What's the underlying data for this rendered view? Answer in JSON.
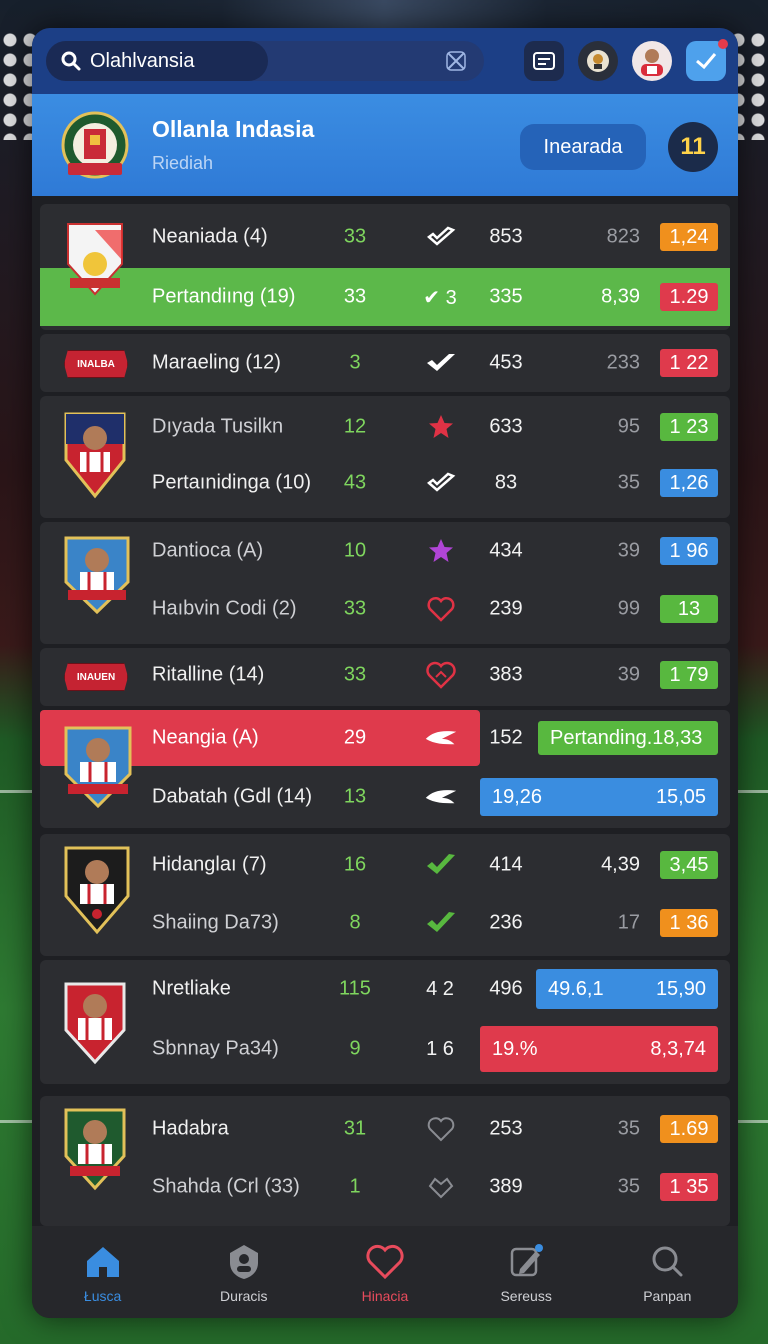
{
  "search": {
    "value": "Olahlvansia"
  },
  "header": {
    "title": "Ollanla Indasia",
    "subtitle": "Riediah",
    "button": "Inearada",
    "badge": "11"
  },
  "colors": {
    "accent": "#2f7ad6",
    "green": "#58b83f",
    "red": "#df3a4c",
    "orange": "#f0901d",
    "blue": "#3a8de0"
  },
  "rows": [
    {
      "name": "Neaniada (4)",
      "v1": "33",
      "icon": "check-icon",
      "v2": "853",
      "v3": "823",
      "pill": "1,24",
      "pill_color": "orange"
    },
    {
      "name": "Pertandiıng (19)",
      "v1": "33",
      "icon_text": "✔ 3",
      "v2": "335",
      "v3": "8,39",
      "pill": "1.29",
      "pill_color": "red"
    },
    {
      "name": "Maraeling (12)",
      "v1": "3",
      "icon": "check-icon",
      "v2": "453",
      "v3": "233",
      "pill": "1 22",
      "pill_color": "red"
    },
    {
      "name": "Dıyada Tusilkn",
      "v1": "12",
      "icon": "star-icon",
      "v2": "633",
      "v3": "95",
      "pill": "1 23",
      "pill_color": "green"
    },
    {
      "name": "Pertaınidinga (10)",
      "v1": "43",
      "icon": "check-icon",
      "v2": "83",
      "v3": "35",
      "pill": "1,26",
      "pill_color": "blue"
    },
    {
      "name": "Dantioca (A)",
      "v1": "10",
      "icon": "star-icon",
      "v2": "434",
      "v3": "39",
      "pill": "1 96",
      "pill_color": "blue"
    },
    {
      "name": "Haıbvin Codi (2)",
      "v1": "33",
      "icon": "heart-icon",
      "v2": "239",
      "v3": "99",
      "pill": "13",
      "pill_color": "green"
    },
    {
      "name": "Ritalline (14)",
      "v1": "33",
      "icon": "heart-icon",
      "v2": "383",
      "v3": "39",
      "pill": "1 79",
      "pill_color": "green"
    },
    {
      "name": "Neangia (A)",
      "v1": "29",
      "icon": "wing-icon",
      "v2": "152",
      "wide": "Pertanding.18,33"
    },
    {
      "name": "Dabatah (Gdl (14)",
      "v1": "13",
      "icon": "wing-icon",
      "wide_left": "19,26",
      "wide_right": "15,05"
    },
    {
      "name": "Hidanglaı (7)",
      "v1": "16",
      "icon": "check-icon",
      "v2": "414",
      "v3": "4,39",
      "pill": "3,45",
      "pill_color": "green"
    },
    {
      "name": "Shaiing Da73)",
      "v1": "8",
      "icon": "check-icon",
      "v2": "236",
      "v3": "17",
      "pill": "1 36",
      "pill_color": "orange"
    },
    {
      "name": "Nretliake",
      "v1": "115",
      "icon_text": "4 2",
      "v2": "496",
      "wide_left": "49.6,1",
      "wide_right": "15,90"
    },
    {
      "name": "Sbnnay Pa34)",
      "v1": "9",
      "icon_text": "1 6",
      "wide_left": "19.%",
      "wide_right": "8,3,74"
    },
    {
      "name": "Hadabra",
      "v1": "31",
      "icon": "heart-icon",
      "v2": "253",
      "v3": "35",
      "pill": "1.69",
      "pill_color": "orange"
    },
    {
      "name": "Shahda (Crl (33)",
      "v1": "1",
      "icon": "heart-icon",
      "v2": "389",
      "v3": "35",
      "pill": "1 35",
      "pill_color": "red"
    }
  ],
  "logos": {
    "banner_1": "INALBA",
    "banner_2": "INAUEN"
  },
  "nav": [
    {
      "label": "Łusca",
      "icon": "home-icon"
    },
    {
      "label": "Duracis",
      "icon": "user-icon"
    },
    {
      "label": "Hinacia",
      "icon": "heart-icon"
    },
    {
      "label": "Sereuss",
      "icon": "edit-icon"
    },
    {
      "label": "Panpan",
      "icon": "search-icon"
    }
  ]
}
